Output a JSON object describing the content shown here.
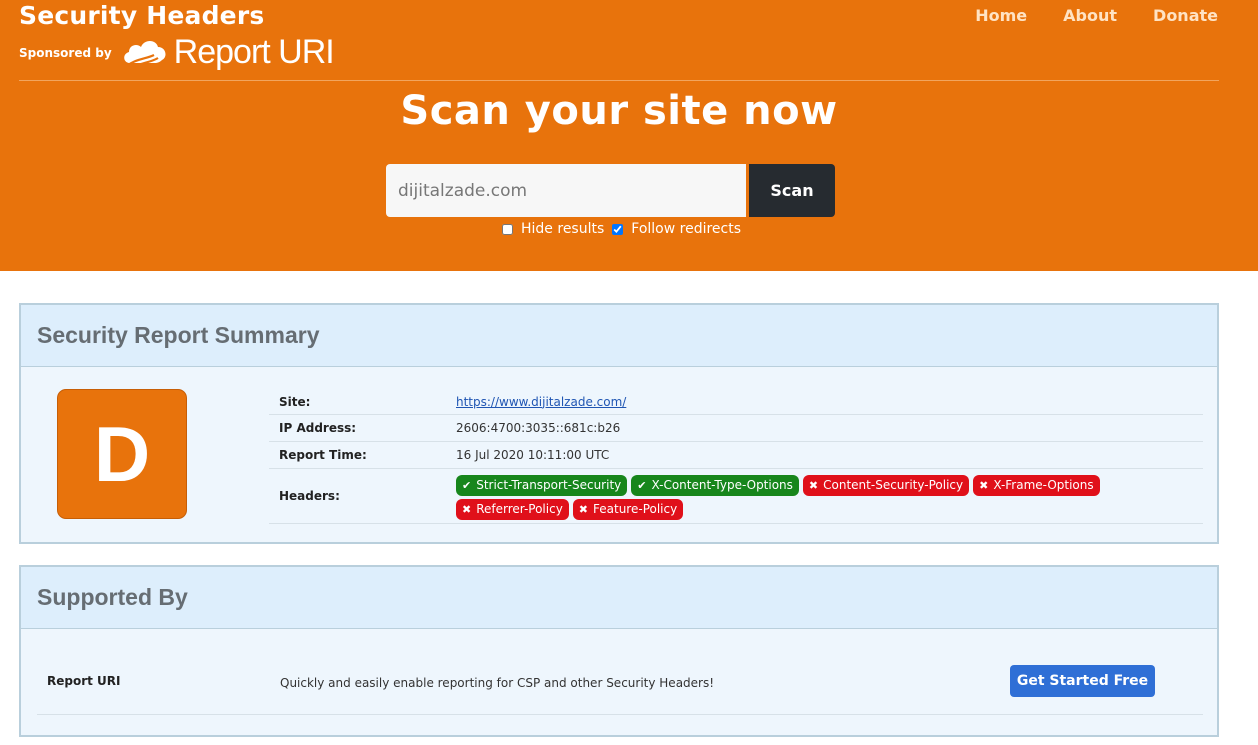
{
  "header": {
    "brand": "Security Headers",
    "sponsored_by": "Sponsored by",
    "sponsor_logo_text": "Report URI",
    "nav": [
      {
        "label": "Home"
      },
      {
        "label": "About"
      },
      {
        "label": "Donate"
      }
    ]
  },
  "scan": {
    "headline": "Scan your site now",
    "input_value": "dijitalzade.com",
    "button_label": "Scan",
    "hide_results_label": "Hide results",
    "hide_results_checked": false,
    "follow_redirects_label": "Follow redirects",
    "follow_redirects_checked": true
  },
  "summary": {
    "title": "Security Report Summary",
    "grade": "D",
    "grade_color": "#e8730c",
    "site_label": "Site:",
    "site_value": "https://www.dijitalzade.com/",
    "ip_label": "IP Address:",
    "ip_value": "2606:4700:3035::681c:b26",
    "time_label": "Report Time:",
    "time_value": "16 Jul 2020 10:11:00 UTC",
    "headers_label": "Headers:",
    "headers": [
      {
        "name": "Strict-Transport-Security",
        "status": "ok"
      },
      {
        "name": "X-Content-Type-Options",
        "status": "ok"
      },
      {
        "name": "Content-Security-Policy",
        "status": "bad"
      },
      {
        "name": "X-Frame-Options",
        "status": "bad"
      },
      {
        "name": "Referrer-Policy",
        "status": "bad"
      },
      {
        "name": "Feature-Policy",
        "status": "bad"
      }
    ]
  },
  "supported": {
    "title": "Supported By",
    "name": "Report URI",
    "description": "Quickly and easily enable reporting for CSP and other Security Headers!",
    "cta_label": "Get Started Free"
  },
  "colors": {
    "brand_orange": "#e8730c",
    "pass_green": "#17861c",
    "fail_red": "#e0101a",
    "cta_blue": "#2f6fd6"
  }
}
